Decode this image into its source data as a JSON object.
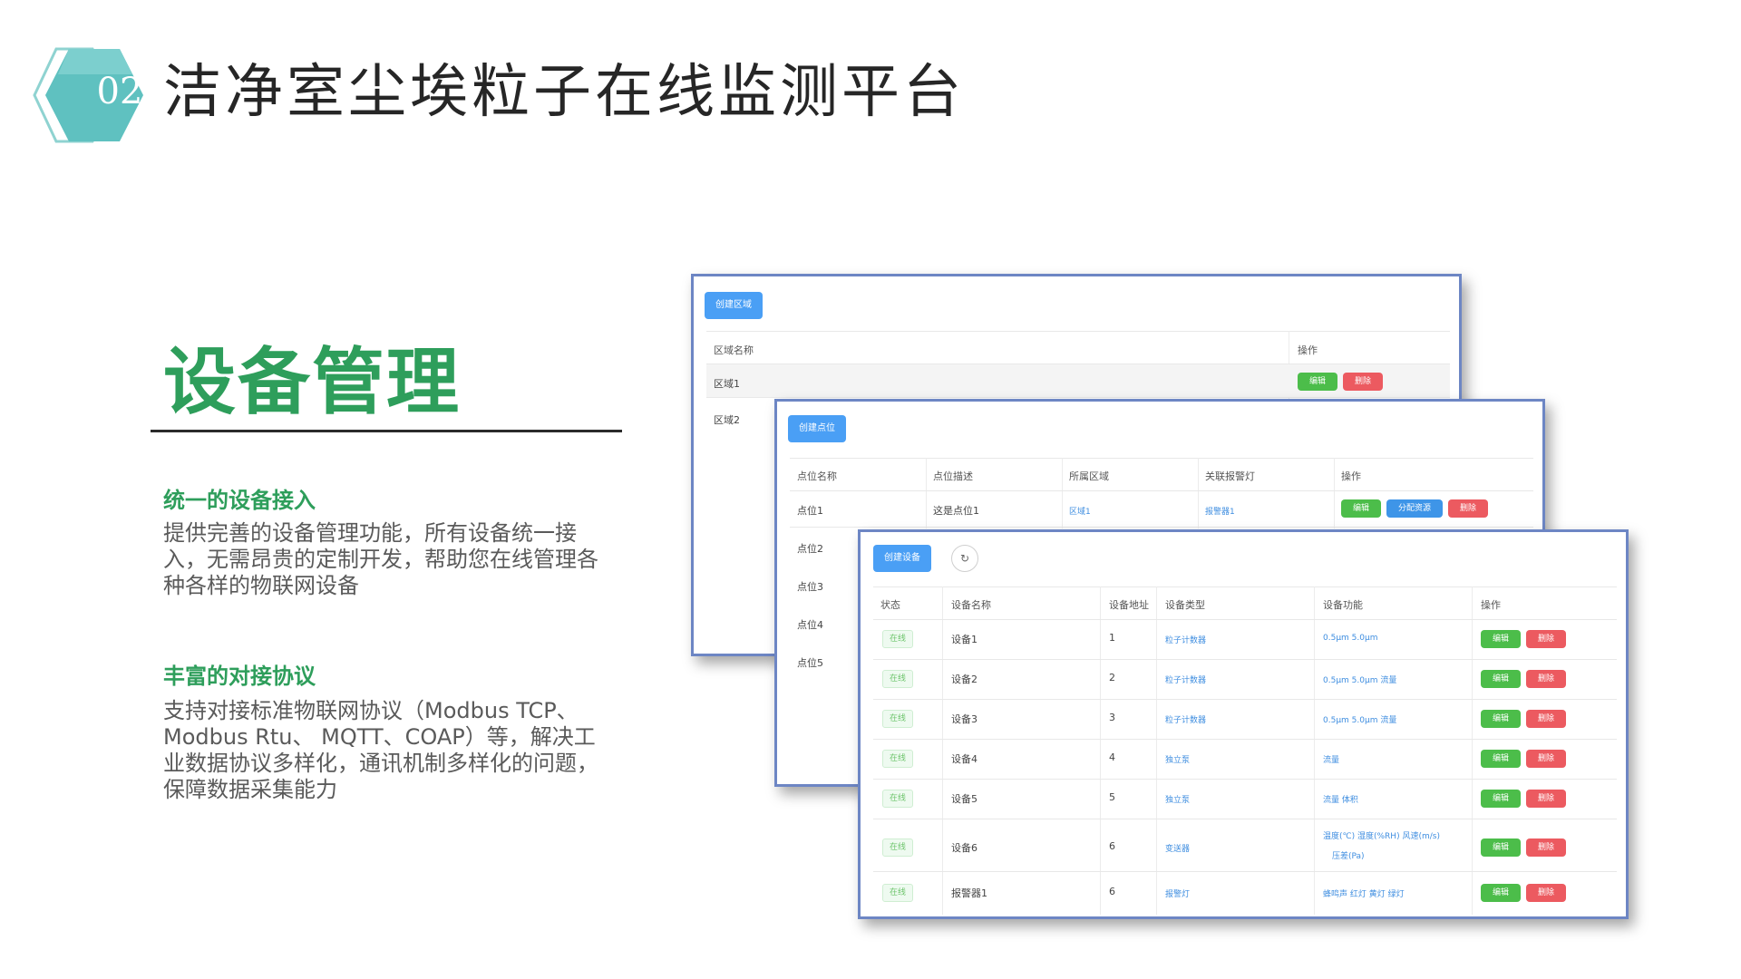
{
  "header": {
    "number": "02",
    "title": "洁净室尘埃粒子在线监测平台",
    "accent": "#5fc1c0"
  },
  "section": {
    "title": "设备管理",
    "title_color": "#2e9e5b",
    "features": [
      {
        "title": "统一的设备接入",
        "desc": "提供完善的设备管理功能，所有设备统一接入，无需昂贵的定制开发，帮助您在线管理各种各样的物联网设备"
      },
      {
        "title": "丰富的对接协议",
        "desc": "支持对接标准物联网协议（Modbus TCP、Modbus Rtu、 MQTT、COAP）等，解决工业数据协议多样化，通讯机制多样化的问题，保障数据采集能力"
      }
    ]
  },
  "zone_panel": {
    "create_label": "创建区域",
    "columns": [
      "区域名称",
      "操作"
    ],
    "rows": [
      "区域1",
      "区域2"
    ],
    "edit_label": "编辑",
    "delete_label": "删除"
  },
  "point_panel": {
    "create_label": "创建点位",
    "columns": [
      "点位名称",
      "点位描述",
      "所属区域",
      "关联报警灯",
      "操作"
    ],
    "first_row": {
      "name": "点位1",
      "desc": "这是点位1",
      "zone": "区域1",
      "alarm": "报警器1"
    },
    "other_rows": [
      "点位2",
      "点位3",
      "点位4",
      "点位5"
    ],
    "edit_label": "编辑",
    "assign_label": "分配资源",
    "delete_label": "删除"
  },
  "device_panel": {
    "create_label": "创建设备",
    "refresh_icon": "refresh-icon",
    "columns": [
      "状态",
      "设备名称",
      "设备地址",
      "设备类型",
      "设备功能",
      "操作"
    ],
    "rows": [
      {
        "status": "在线",
        "name": "设备1",
        "address": "1",
        "type": "粒子计数器",
        "functions": "0.5μm  5.0μm"
      },
      {
        "status": "在线",
        "name": "设备2",
        "address": "2",
        "type": "粒子计数器",
        "functions": "0.5μm  5.0μm  流量"
      },
      {
        "status": "在线",
        "name": "设备3",
        "address": "3",
        "type": "粒子计数器",
        "functions": "0.5μm  5.0μm  流量"
      },
      {
        "status": "在线",
        "name": "设备4",
        "address": "4",
        "type": "独立泵",
        "functions": "流量"
      },
      {
        "status": "在线",
        "name": "设备5",
        "address": "5",
        "type": "独立泵",
        "functions": "流量  体积"
      },
      {
        "status": "在线",
        "name": "设备6",
        "address": "6",
        "type": "变送器",
        "functions": "温度(℃)  湿度(%RH)  风速(m/s)",
        "functions2": "压差(Pa)"
      },
      {
        "status": "在线",
        "name": "报警器1",
        "address": "6",
        "type": "报警灯",
        "functions": "蜂鸣声  红灯  黄灯  绿灯"
      }
    ],
    "edit_label": "编辑",
    "delete_label": "删除"
  }
}
